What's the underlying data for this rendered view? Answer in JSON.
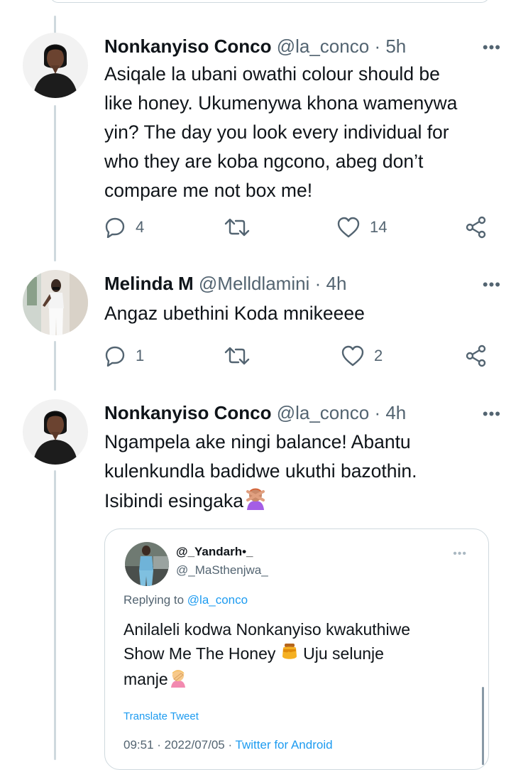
{
  "tweets": [
    {
      "name": "Nonkanyiso Conco",
      "handle": "@la_conco",
      "separator": "·",
      "time": "5h",
      "lines": [
        "Asiqale la ubani owathi colour should be",
        "like honey. Ukumenywa khona wamenywa",
        "yin? The day you look every individual for",
        "who they are koba ngcono, abeg don’t",
        "compare me not box me!"
      ],
      "replies": "4",
      "retweets": "",
      "likes": "14"
    },
    {
      "name": "Melinda M",
      "handle": "@Melldlamini",
      "separator": "·",
      "time": "4h",
      "lines": [
        "Angaz ubethini Koda mnikeeee"
      ],
      "replies": "1",
      "retweets": "",
      "likes": "2"
    },
    {
      "name": "Nonkanyiso Conco",
      "handle": "@la_conco",
      "separator": "·",
      "time": "4h",
      "lines": [
        "Ngampela ake ningi balance! Abantu",
        "kulenkundla badidwe ukuthi bazothin.",
        "Isibindi esingaka"
      ],
      "emoji": "person-gesturing-no"
    }
  ],
  "more_glyph": "•••",
  "quote": {
    "name": "@_Yandarh•_",
    "handle": "@_MaSthenjwa_",
    "replying_prefix": "Replying to ",
    "replying_to": "@la_conco",
    "lines": [
      "Anilaleli kodwa Nonkanyiso kwakuthiwe",
      "Show Me The Honey",
      "Uju selunje",
      "manje"
    ],
    "emojis": [
      "honey-pot",
      "person-facepalming"
    ],
    "translate": "Translate Tweet",
    "meta_time": "09:51 · 2022/07/05 · ",
    "meta_source": "Twitter for Android"
  },
  "colors": {
    "text": "#0f1419",
    "secondary": "#536471",
    "accent": "#1d9bf0",
    "border": "#cfd9de"
  }
}
